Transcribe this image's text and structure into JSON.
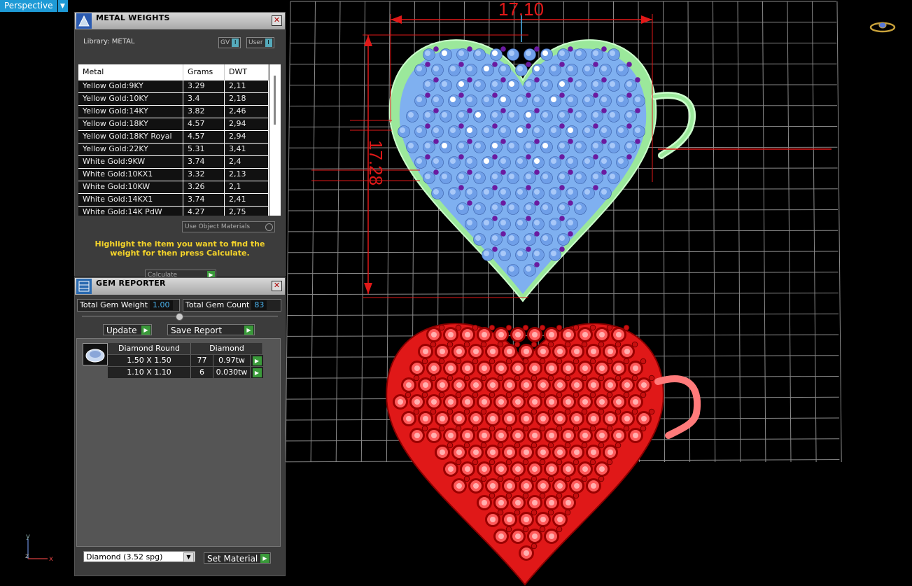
{
  "viewport": {
    "view_label": "Perspective",
    "dimension_width": "17.10",
    "dimension_height": "17.28",
    "axis_y": "y",
    "axis_z": "z",
    "axis_x": "x",
    "heart_top_color": "#7fb0f0",
    "heart_bottom_color": "#e01818",
    "bead_color": "#6a1aa0",
    "dimension_color": "#e01818"
  },
  "metal_weights": {
    "title": "METAL WEIGHTS",
    "library_label": "Library: METAL",
    "toggle_gv": "GV",
    "toggle_user": "User",
    "columns": [
      "Metal",
      "Grams",
      "DWT"
    ],
    "rows": [
      [
        "Yellow Gold:9KY",
        "3.29",
        "2,11"
      ],
      [
        "Yellow Gold:10KY",
        "3.4",
        "2,18"
      ],
      [
        "Yellow Gold:14KY",
        "3.82",
        "2,46"
      ],
      [
        "Yellow Gold:18KY",
        "4.57",
        "2,94"
      ],
      [
        "Yellow Gold:18KY Royal",
        "4.57",
        "2,94"
      ],
      [
        "Yellow Gold:22KY",
        "5.31",
        "3,41"
      ],
      [
        "White Gold:9KW",
        "3.74",
        "2,4"
      ],
      [
        "White Gold:10KX1",
        "3.32",
        "2,13"
      ],
      [
        "White Gold:10KW",
        "3.26",
        "2,1"
      ],
      [
        "White Gold:14KX1",
        "3.74",
        "2,41"
      ],
      [
        "White Gold:14K PdW",
        "4.27",
        "2,75"
      ]
    ],
    "use_object_materials": "Use Object Materials",
    "hint": "Highlight the item you want to find the weight for then press Calculate.",
    "calculate_button": "Calculate"
  },
  "gem_reporter": {
    "title": "GEM REPORTER",
    "total_weight_label": "Total Gem Weight",
    "total_weight_value": "1.00",
    "total_count_label": "Total Gem Count",
    "total_count_value": "83",
    "update_button": "Update",
    "save_report_button": "Save Report",
    "table_header": [
      "Diamond Round",
      "Diamond"
    ],
    "rows": [
      [
        "1.50 X 1.50",
        "77",
        "0.97tw"
      ],
      [
        "1.10 X 1.10",
        "6",
        "0.030tw"
      ]
    ],
    "material_select": "Diamond    (3.52 spg)",
    "set_material_button": "Set Material"
  }
}
